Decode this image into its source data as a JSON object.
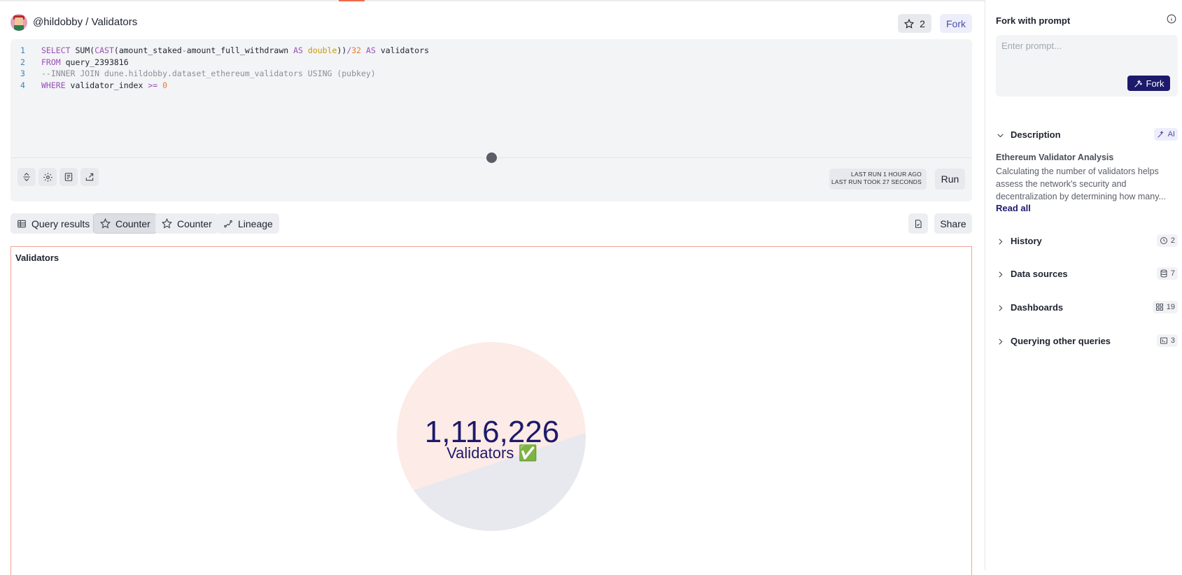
{
  "header": {
    "title": "@hildobby / Validators",
    "star_count": "2",
    "fork_label": "Fork"
  },
  "editor": {
    "lines": [
      {
        "num": "1"
      },
      {
        "num": "2"
      },
      {
        "num": "3"
      },
      {
        "num": "4"
      }
    ],
    "line1": {
      "kw1": "SELECT",
      "fn1": "SUM",
      "p1": "(",
      "fn2": "CAST",
      "p2": "(amount_staked",
      "op1": "-",
      "p3": "amount_full_withdrawn ",
      "kw2": "AS",
      "sp": " ",
      "ty": "double",
      "p4": "))",
      "op2": "/",
      "num": "32",
      "sp2": " ",
      "kw3": "AS",
      "p5": " validators"
    },
    "line2": {
      "kw": "FROM",
      "rest": " query_2393816"
    },
    "line3": {
      "comment": "--INNER JOIN dune.hildobby.dataset_ethereum_validators USING (pubkey)"
    },
    "line4": {
      "kw": "WHERE",
      "rest": " validator_index ",
      "op": ">=",
      "sp": " ",
      "num": "0"
    },
    "last_run_line1": "LAST RUN 1 HOUR AGO",
    "last_run_line2": "LAST RUN TOOK 27 SECONDS",
    "run_label": "Run"
  },
  "tabs": [
    {
      "label": "Query results",
      "icon": "table-icon"
    },
    {
      "label": "Counter",
      "icon": "star-icon",
      "active": true
    },
    {
      "label": "Counter",
      "icon": "star-icon"
    },
    {
      "label": "Lineage",
      "icon": "lineage-icon"
    }
  ],
  "share_label": "Share",
  "visualization": {
    "title": "Validators",
    "counter_value": "1,116,226",
    "counter_label": "Validators ✅",
    "colors": {
      "circle_top": "#fcebe6",
      "circle_bottom": "#e8e8ef",
      "text": "#1d1a6b"
    }
  },
  "sidebar": {
    "title": "Fork with prompt",
    "prompt_placeholder": "Enter prompt...",
    "fork_label": "Fork",
    "sections": {
      "description": {
        "label": "Description",
        "badge": "AI"
      },
      "history": {
        "label": "History",
        "badge": "2"
      },
      "data_sources": {
        "label": "Data sources",
        "badge": "7"
      },
      "dashboards": {
        "label": "Dashboards",
        "badge": "19"
      },
      "querying": {
        "label": "Querying other queries",
        "badge": "3"
      }
    },
    "description_title": "Ethereum Validator Analysis",
    "description_text": "Calculating the number of validators helps assess the network's security and decentralization by determining how many...",
    "read_all": "Read all"
  },
  "colors": {
    "accent": "#1d1a6b",
    "brand_orange": "#ef6a4b"
  }
}
